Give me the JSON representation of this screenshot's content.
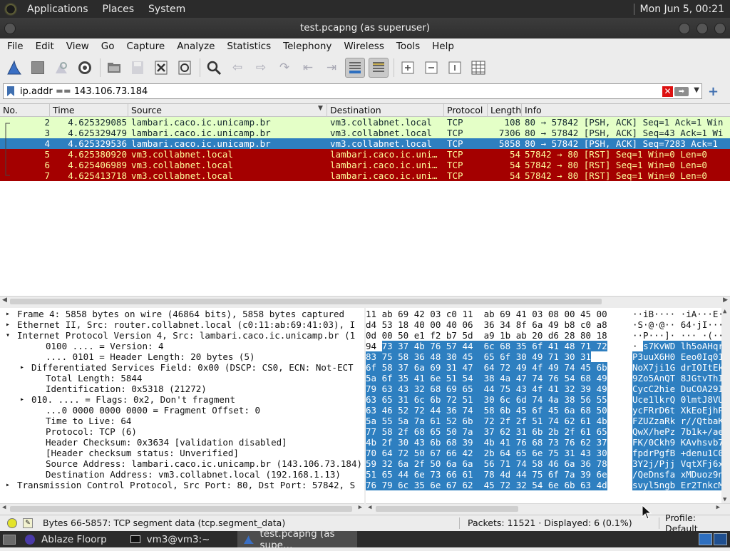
{
  "top_panel": {
    "menus": [
      "Applications",
      "Places",
      "System"
    ],
    "clock": "Mon Jun  5, 00:21"
  },
  "window": {
    "title": "test.pcapng (as superuser)"
  },
  "menubar": [
    "File",
    "Edit",
    "View",
    "Go",
    "Capture",
    "Analyze",
    "Statistics",
    "Telephony",
    "Wireless",
    "Tools",
    "Help"
  ],
  "filter": {
    "value": "ip.addr == 143.106.73.184"
  },
  "packet_list": {
    "columns": [
      "No.",
      "Time",
      "Source",
      "Destination",
      "Protocol",
      "Length",
      "Info"
    ],
    "rows": [
      {
        "no": "2",
        "time": "4.625329085",
        "source": "lambari.caco.ic.unicamp.br",
        "destination": "vm3.collabnet.local",
        "protocol": "TCP",
        "length": "108",
        "info": "80 → 57842 [PSH, ACK] Seq=1 Ack=1 Win",
        "style": "green"
      },
      {
        "no": "3",
        "time": "4.625329479",
        "source": "lambari.caco.ic.unicamp.br",
        "destination": "vm3.collabnet.local",
        "protocol": "TCP",
        "length": "7306",
        "info": "80 → 57842 [PSH, ACK] Seq=43 Ack=1 Wi",
        "style": "green"
      },
      {
        "no": "4",
        "time": "4.625329536",
        "source": "lambari.caco.ic.unicamp.br",
        "destination": "vm3.collabnet.local",
        "protocol": "TCP",
        "length": "5858",
        "info": "80 → 57842 [PSH, ACK] Seq=7283 Ack=1",
        "style": "selected"
      },
      {
        "no": "5",
        "time": "4.625380920",
        "source": "vm3.collabnet.local",
        "destination": "lambari.caco.ic.uni…",
        "protocol": "TCP",
        "length": "54",
        "info": "57842 → 80 [RST] Seq=1 Win=0 Len=0",
        "style": "red"
      },
      {
        "no": "6",
        "time": "4.625406989",
        "source": "vm3.collabnet.local",
        "destination": "lambari.caco.ic.uni…",
        "protocol": "TCP",
        "length": "54",
        "info": "57842 → 80 [RST] Seq=1 Win=0 Len=0",
        "style": "red"
      },
      {
        "no": "7",
        "time": "4.625413718",
        "source": "vm3.collabnet.local",
        "destination": "lambari.caco.ic.uni…",
        "protocol": "TCP",
        "length": "54",
        "info": "57842 → 80 [RST] Seq=1 Win=0 Len=0",
        "style": "red"
      }
    ]
  },
  "details": [
    {
      "arrow": "▸",
      "text": "Frame 4: 5858 bytes on wire (46864 bits), 5858 bytes captured"
    },
    {
      "arrow": "▸",
      "text": "Ethernet II, Src: router.collabnet.local (c0:11:ab:69:41:03), I"
    },
    {
      "arrow": "▾",
      "text": "Internet Protocol Version 4, Src: lambari.caco.ic.unicamp.br (1"
    },
    {
      "arrow": "",
      "text": "0100 .... = Version: 4",
      "indent": 2
    },
    {
      "arrow": "",
      "text": ".... 0101 = Header Length: 20 bytes (5)",
      "indent": 2
    },
    {
      "arrow": "▸",
      "text": "Differentiated Services Field: 0x00 (DSCP: CS0, ECN: Not-ECT",
      "indent": 1
    },
    {
      "arrow": "",
      "text": "Total Length: 5844",
      "indent": 2
    },
    {
      "arrow": "",
      "text": "Identification: 0x5318 (21272)",
      "indent": 2
    },
    {
      "arrow": "▸",
      "text": "010. .... = Flags: 0x2, Don't fragment",
      "indent": 1
    },
    {
      "arrow": "",
      "text": "...0 0000 0000 0000 = Fragment Offset: 0",
      "indent": 2
    },
    {
      "arrow": "",
      "text": "Time to Live: 64",
      "indent": 2
    },
    {
      "arrow": "",
      "text": "Protocol: TCP (6)",
      "indent": 2
    },
    {
      "arrow": "",
      "text": "Header Checksum: 0x3634 [validation disabled]",
      "indent": 2
    },
    {
      "arrow": "",
      "text": "[Header checksum status: Unverified]",
      "indent": 2
    },
    {
      "arrow": "",
      "text": "Source Address: lambari.caco.ic.unicamp.br (143.106.73.184)",
      "indent": 2
    },
    {
      "arrow": "",
      "text": "Destination Address: vm3.collabnet.local (192.168.1.13)",
      "indent": 2
    },
    {
      "arrow": "▸",
      "text": "Transmission Control Protocol, Src Port: 80, Dst Port: 57842, S"
    }
  ],
  "bytes": [
    {
      "pre": "11 ab 69 42 03 c0 11  ab 69 41 03 08 00 45 00",
      "hex_hl": "",
      "mid": "   ",
      "ascii_pre": "··iB···· ·iA···E·",
      "ascii_hl": ""
    },
    {
      "pre": "d4 53 18 40 00 40 06  36 34 8f 6a 49 b8 c0 a8",
      "hex_hl": "",
      "mid": "   ",
      "ascii_pre": "·S·@·@·· 64·jI···",
      "ascii_hl": ""
    },
    {
      "pre": "0d 00 50 e1 f2 b7 5d  a9 1b ab 20 d6 28 80 18",
      "hex_hl": "",
      "mid": "   ",
      "ascii_pre": "··P···]· ··· ·(··",
      "ascii_hl": ""
    },
    {
      "pre": "94 ",
      "hex_hl": "73 37 4b 76 57 44  6c 68 35 6f 41 48 71 72",
      "mid": "   ",
      "ascii_pre": "· ",
      "ascii_hl": "s7KvWD lh5oAHqr"
    },
    {
      "pre": "",
      "hex_hl": "83 75 58 36 48 30 45  65 6f 30 49 71 30 31",
      "mid": "   ",
      "ascii_pre": "",
      "ascii_hl": "P3uuX6H0 Eeo0Iq01"
    },
    {
      "pre": "",
      "hex_hl": "6f 58 37 6a 69 31 47  64 72 49 4f 49 74 45 6b",
      "mid": "   ",
      "ascii_pre": "",
      "ascii_hl": "NoX7ji1G drIOItEk"
    },
    {
      "pre": "",
      "hex_hl": "5a 6f 35 41 6e 51 54  38 4a 47 74 76 54 68 49",
      "mid": "   ",
      "ascii_pre": "",
      "ascii_hl": "9Zo5AnQT 8JGtvThI"
    },
    {
      "pre": "",
      "hex_hl": "79 63 43 32 68 69 65  44 75 43 4f 41 32 39 49",
      "mid": "   ",
      "ascii_pre": "",
      "ascii_hl": "CycC2hie DuCOA29I"
    },
    {
      "pre": "",
      "hex_hl": "63 65 31 6c 6b 72 51  30 6c 6d 74 4a 38 56 55",
      "mid": "   ",
      "ascii_pre": "",
      "ascii_hl": "Uce1lkrQ 0lmtJ8VU"
    },
    {
      "pre": "",
      "hex_hl": "63 46 52 72 44 36 74  58 6b 45 6f 45 6a 68 50",
      "mid": "   ",
      "ascii_pre": "",
      "ascii_hl": "ycFRrD6t XkEoEjhP"
    },
    {
      "pre": "",
      "hex_hl": "5a 55 5a 7a 61 52 6b  72 2f 2f 51 74 62 61 4b",
      "mid": "   ",
      "ascii_pre": "",
      "ascii_hl": "FZUZzaRk r//QtbaK"
    },
    {
      "pre": "",
      "hex_hl": "77 58 2f 68 65 50 7a  37 62 31 6b 2b 2f 61 65",
      "mid": "   ",
      "ascii_pre": "",
      "ascii_hl": "QwX/hePz 7b1k+/ae"
    },
    {
      "pre": "",
      "hex_hl": "4b 2f 30 43 6b 68 39  4b 41 76 68 73 76 62 37",
      "mid": "   ",
      "ascii_pre": "",
      "ascii_hl": "FK/0Ckh9 KAvhsvb7"
    },
    {
      "pre": "",
      "hex_hl": "70 64 72 50 67 66 42  2b 64 65 6e 75 31 43 30",
      "mid": "   ",
      "ascii_pre": "",
      "ascii_hl": "fpdrPgfB +denu1C0"
    },
    {
      "pre": "",
      "hex_hl": "59 32 6a 2f 50 6a 6a  56 71 74 58 46 6a 36 78",
      "mid": "   ",
      "ascii_pre": "",
      "ascii_hl": "3Y2j/Pjj VqtXFj6x"
    },
    {
      "pre": "",
      "hex_hl": "51 65 44 6e 73 66 61  78 4d 44 75 6f 7a 39 6e",
      "mid": "   ",
      "ascii_pre": "",
      "ascii_hl": "/QeDnsfa xMDuoz9n"
    },
    {
      "pre": "",
      "hex_hl": "76 79 6c 35 6e 67 62  45 72 32 54 6e 6b 63 4d",
      "mid": "   ",
      "ascii_pre": "",
      "ascii_hl": "svyl5ngb Er2TnkcM"
    }
  ],
  "status": {
    "text": "Bytes 66-5857: TCP segment data (tcp.segment_data)",
    "packets": "Packets: 11521 · Displayed: 6 (0.1%)",
    "profile": "Profile: Default"
  },
  "taskbar": {
    "items": [
      "Ablaze Floorp",
      "vm3@vm3:~",
      "test.pcapng (as supe…"
    ]
  }
}
